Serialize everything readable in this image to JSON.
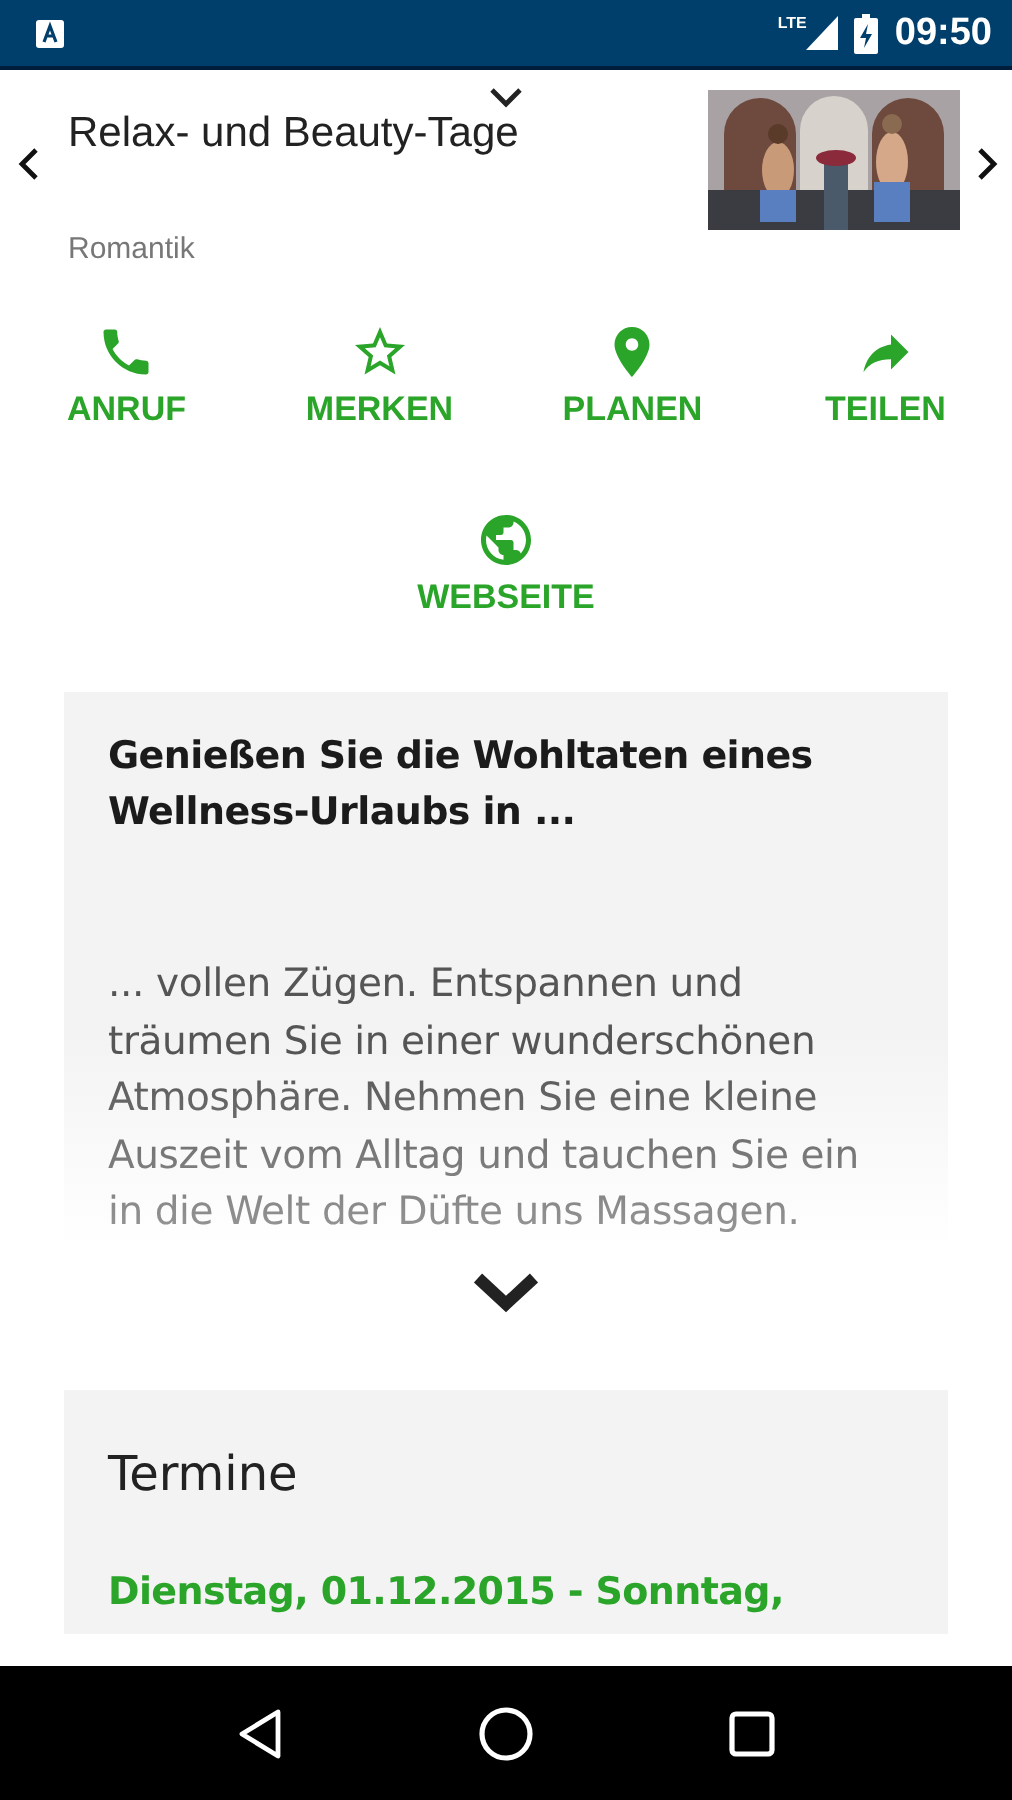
{
  "status_bar": {
    "network": "LTE",
    "time": "09:50"
  },
  "header": {
    "title": "Relax- und Beauty-Tage",
    "category": "Romantik"
  },
  "actions": [
    {
      "kind": "call",
      "label": "ANRUF"
    },
    {
      "kind": "bookmark",
      "label": "MERKEN"
    },
    {
      "kind": "plan",
      "label": "PLANEN"
    },
    {
      "kind": "share",
      "label": "TEILEN"
    },
    {
      "kind": "website",
      "label": "WEBSEITE"
    }
  ],
  "description": {
    "title": "Genießen Sie die Wohltaten eines Wellness-Urlaubs in ...",
    "text": "... vollen Zügen. Entspannen und träumen Sie in einer wunderschönen Atmosphäre. Nehmen Sie eine kleine Auszeit vom Alltag und tauchen Sie ein in die Welt der Düfte uns Massagen."
  },
  "dates": {
    "title": "Termine",
    "entries": [
      "Dienstag, 01.12.2015 - Sonntag,"
    ]
  }
}
